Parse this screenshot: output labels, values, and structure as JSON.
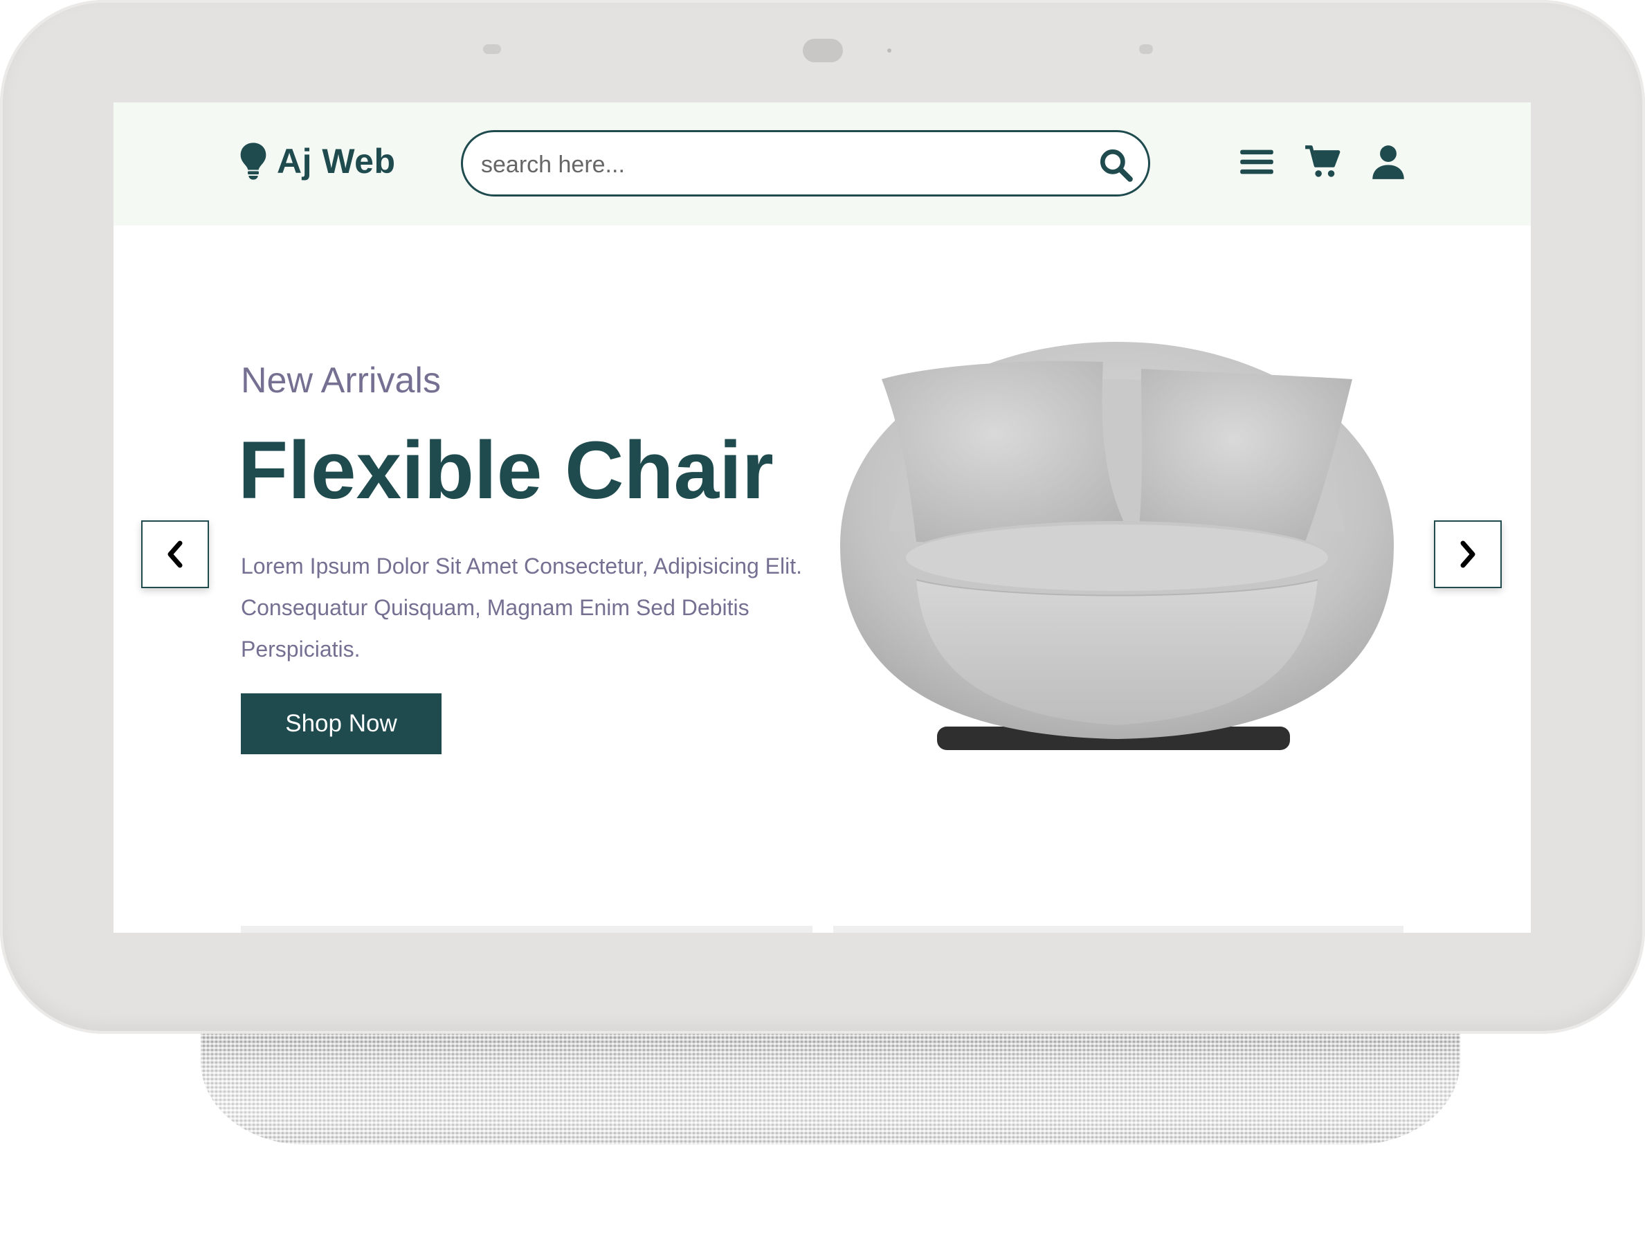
{
  "header": {
    "brand": "Aj Web",
    "search": {
      "placeholder": "search here...",
      "value": ""
    },
    "icons": [
      "bulb-icon",
      "search-icon",
      "menu-icon",
      "cart-icon",
      "user-icon"
    ]
  },
  "hero": {
    "subtitle": "New Arrivals",
    "title": "Flexible Chair",
    "description": "Lorem Ipsum Dolor Sit Amet Consectetur, Adipisicing Elit. Consequatur Quisquam, Magnam Enim Sed Debitis Perspiciatis.",
    "cta_label": "Shop Now",
    "image": "armchair-image"
  },
  "slider": {
    "prev_icon": "chevron-left-icon",
    "next_icon": "chevron-right-icon"
  },
  "colors": {
    "primary": "#1f4b4f",
    "muted_text": "#757092",
    "header_bg": "#f4f9f4",
    "device_frame": "#e3e2e1"
  }
}
